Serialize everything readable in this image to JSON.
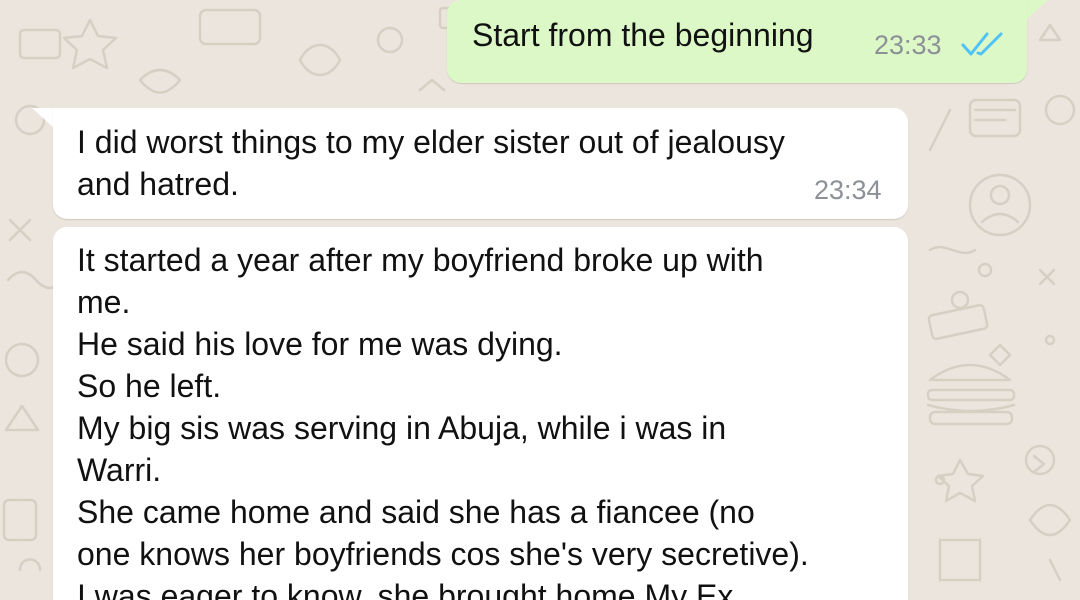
{
  "colors": {
    "wallpaper": "#ece5dd",
    "outgoing_bubble": "#dcf8c6",
    "incoming_bubble": "#ffffff",
    "timestamp": "#8d9197",
    "read_ticks": "#4fc3f7"
  },
  "messages": [
    {
      "direction": "outgoing",
      "text": "Start from the beginning",
      "time": "23:33",
      "status_icon": "double-check-read-icon"
    },
    {
      "direction": "incoming",
      "text": "I did worst things to my elder sister out of jealousy\nand hatred.",
      "time": "23:34"
    },
    {
      "direction": "incoming",
      "text": "It started a year after my boyfriend broke up with\nme.\nHe said his love for me was dying.\nSo he left.\nMy big sis was serving in Abuja, while i was in\nWarri.\nShe came home and said she has a fiancee  (no\none knows her boyfriends cos she's very secretive).\nI was eager to know, she brought home My Ex"
    }
  ]
}
